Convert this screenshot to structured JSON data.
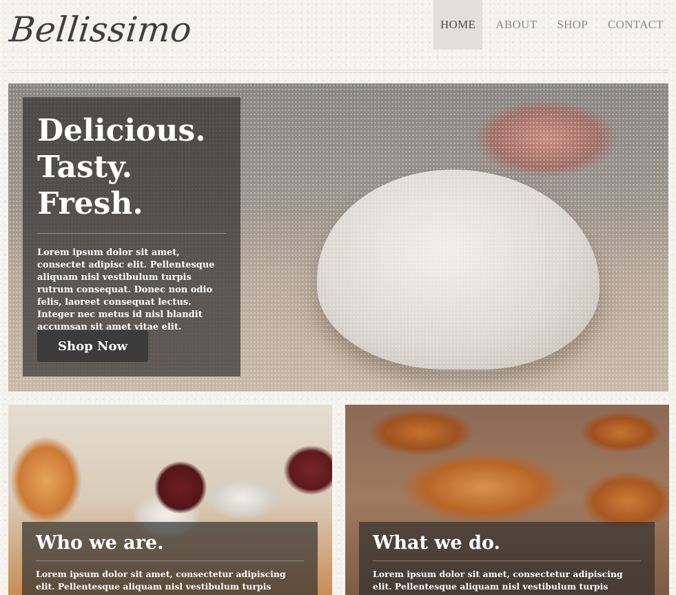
{
  "brand": {
    "logo_text": "Bellissimo"
  },
  "nav": {
    "items": [
      {
        "label": "HOME",
        "active": true
      },
      {
        "label": "ABOUT",
        "active": false
      },
      {
        "label": "SHOP",
        "active": false
      },
      {
        "label": "CONTACT",
        "active": false
      }
    ]
  },
  "hero": {
    "headline": [
      "Delicious.",
      "Tasty.",
      "Fresh."
    ],
    "body": "Lorem ipsum dolor sit amet, consectet adipisc elit. Pellentesque aliquam nisl vestibulum turpis rutrum consequat. Donec non odio felis, laoreet consequat lectus. Integer nec metus id nisl blandit accumsan sit amet vitae elit.",
    "button_label": "Shop Now"
  },
  "cards": [
    {
      "title": "Who we are.",
      "body": "Lorem ipsum dolor sit amet, consectetur adipiscing elit. Pellentesque aliquam nisl vestibulum turpis rutrum."
    },
    {
      "title": "What we do.",
      "body": "Lorem ipsum dolor sit amet, consectetur adipiscing elit. Pellentesque aliquam nisl vestibulum turpis rutrum."
    }
  ],
  "colors": {
    "page_background": "#f5f2ee",
    "nav_active_bg": "#e2e0de",
    "overlay_bg": "#2d2d2d",
    "button_bg": "#3b3b3b"
  }
}
